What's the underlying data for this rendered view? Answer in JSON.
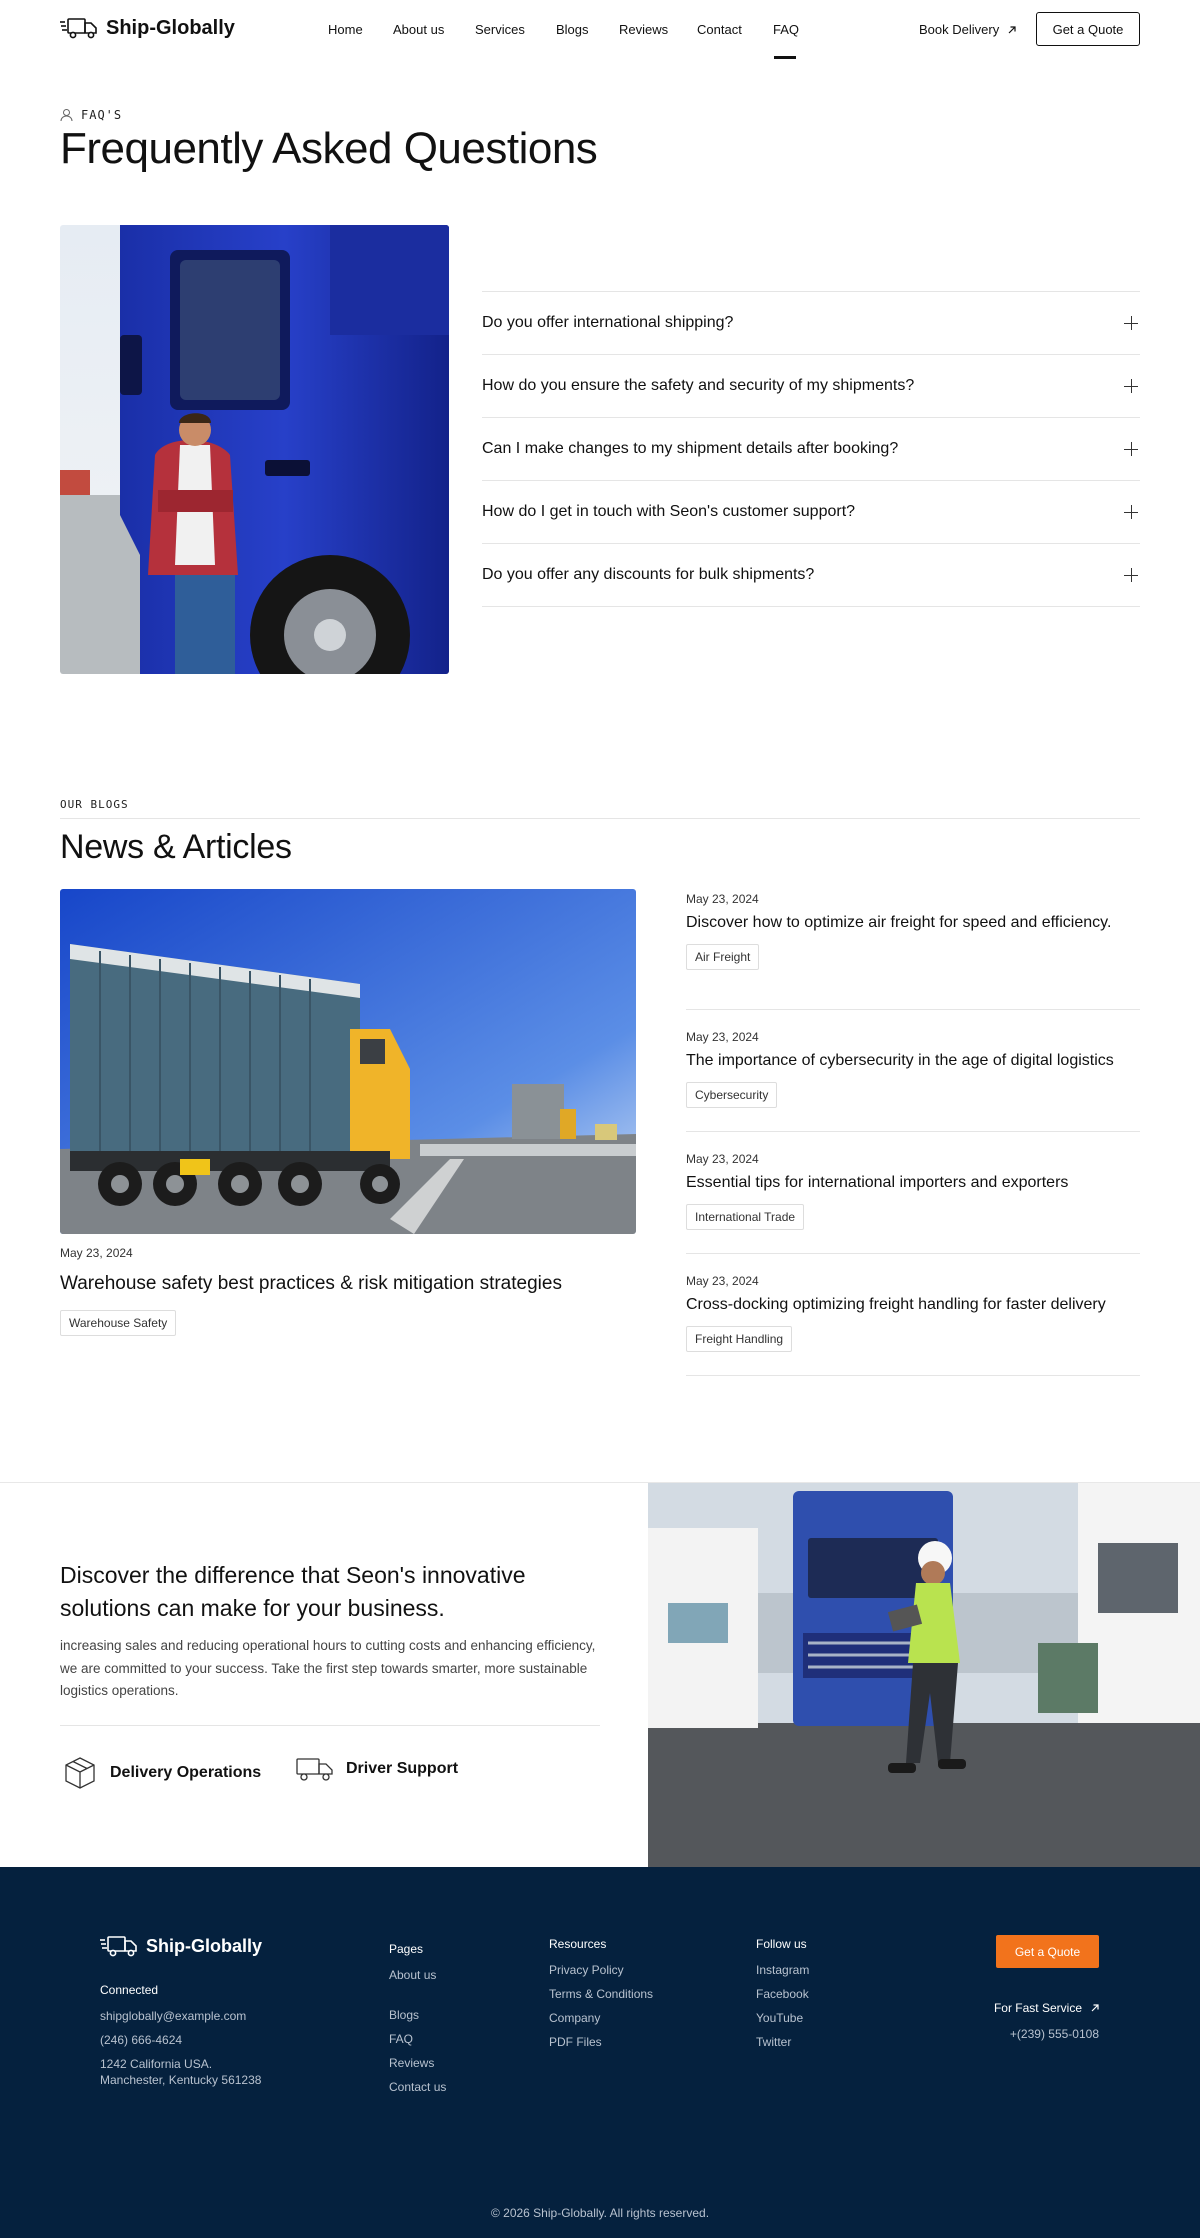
{
  "brand": {
    "name": "Ship-Globally",
    "accent": "#f2731c",
    "footer_bg": "#05213e"
  },
  "nav": {
    "items": [
      "Home",
      "About us",
      "Services",
      "Blogs",
      "Reviews",
      "Contact",
      "FAQ"
    ],
    "active": "FAQ",
    "book_delivery": "Book Delivery",
    "quote": "Get a Quote"
  },
  "faq": {
    "eyebrow": "FAQ'S",
    "title": "Frequently Asked Questions",
    "questions": [
      "Do you offer international shipping?",
      "How do you ensure the safety and security of my shipments?",
      "Can I make changes to my shipment details after booking?",
      "How do I get in touch with Seon's customer support?",
      "Do you offer any discounts for bulk shipments?"
    ]
  },
  "blogs": {
    "eyebrow": "OUR BLOGS",
    "title": "News & Articles",
    "featured": {
      "date": "May 23, 2024",
      "title": "Warehouse safety best practices & risk mitigation strategies",
      "tag": "Warehouse Safety"
    },
    "posts": [
      {
        "date": "May 23, 2024",
        "title": "Discover how to optimize air freight for speed and efficiency.",
        "tag": "Air Freight"
      },
      {
        "date": "May 23, 2024",
        "title": "The importance of cybersecurity in the age of digital logistics",
        "tag": "Cybersecurity"
      },
      {
        "date": "May 23, 2024",
        "title": "Essential tips for international importers and exporters",
        "tag": "International Trade"
      },
      {
        "date": "May 23, 2024",
        "title": "Cross-docking optimizing freight handling for faster delivery",
        "tag": "Freight Handling"
      }
    ]
  },
  "cta": {
    "heading": "Discover the difference that Seon's innovative solutions can make for your business.",
    "body": "increasing sales and reducing operational hours to cutting costs and enhancing efficiency, we are committed to your success. Take the first step towards smarter, more sustainable logistics operations.",
    "features": [
      "Delivery Operations",
      "Driver Support"
    ]
  },
  "footer": {
    "connected_label": "Connected",
    "email": "shipglobally@example.com",
    "phone": "(246) 666-4624",
    "address_line1": "1242 California USA.",
    "address_line2": "Manchester, Kentucky 561238",
    "pages_label": "Pages",
    "pages": [
      "About us",
      "Blogs",
      "FAQ",
      "Reviews",
      "Contact us"
    ],
    "resources_label": "Resources",
    "resources": [
      "Privacy Policy",
      "Terms & Conditions",
      "Company",
      "PDF Files"
    ],
    "follow_label": "Follow us",
    "social": [
      "Instagram",
      "Facebook",
      "YouTube",
      "Twitter"
    ],
    "quote": "Get a Quote",
    "fast_service": "For Fast Service",
    "fast_phone": "+(239) 555-0108",
    "copyright": "© 2026 Ship-Globally. All rights reserved."
  }
}
